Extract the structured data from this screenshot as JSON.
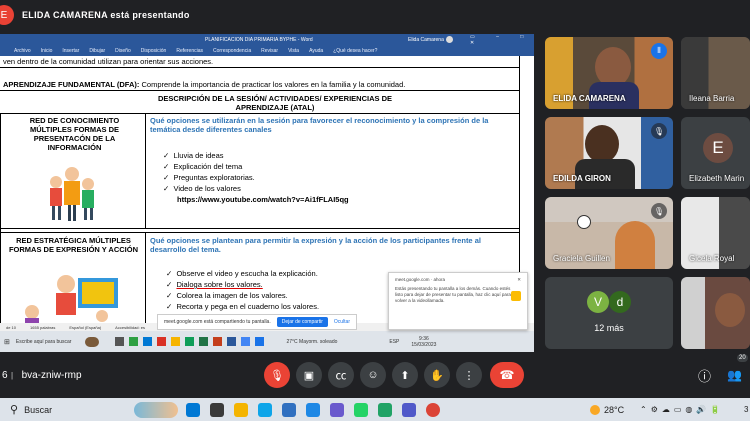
{
  "presenter": {
    "text": "ELIDA CAMARENA está presentando"
  },
  "word": {
    "title": "PLANIFICACION DIA   PRIMARIA BYPHE  -  Word",
    "user": "Elida Camarena",
    "menu": [
      "Archivo",
      "Inicio",
      "Insertar",
      "Dibujar",
      "Diseño",
      "Disposición",
      "Referencias",
      "Correspondencia",
      "Revisar",
      "Vista",
      "Ayuda",
      "¿Qué desea hacer?"
    ],
    "top_fragment": "ven dentro de la comunidad utilizan para orientar sus acciones.",
    "dfa_label": "APRENDIZAJE FUNDAMENTAL (DFA):",
    "dfa_text": "Comprende la importancia de practicar los valores en la familia y la comunidad.",
    "header_line1": "DESCRIPCIÓN DE LA SESIÓN/ ACTIVIDADES/ EXPERIENCIAS DE",
    "header_line2": "APRENDIZAJE (ATAL)",
    "red1_title": "RED DE CONOCIMIENTO MÚLTIPLES FORMAS DE PRESENTACÓN DE LA INFORMACIÓN",
    "red1_question": "Qué opciones se utilizarán en la sesión para favorecer el reconocimiento y la compresión de la temática desde diferentes canales",
    "red1_items": [
      "Lluvia de ideas",
      "Explicación del tema",
      "Preguntas exploratorias.",
      "Video de los valores"
    ],
    "red1_link": "https://www.youtube.com/watch?v=Ai1fFLAI5qg",
    "red2_title": "RED ESTRATÉGICA MÚLTIPLES FORMAS DE EXPRESIÓN Y ACCIÓN",
    "red2_question": "Qué opciones se plantean para permitir la expresión y la acción de los participantes frente al desarrollo del tema.",
    "red2_items": [
      "Observe el video y escucha la explicación.",
      "Dialoga sobre los valores.",
      "Colorea la imagen de los valores.",
      "Recorta y pega en el cuaderno los valores."
    ],
    "status": [
      "de 10",
      "1655 palabras",
      "Español (España)",
      "Accesibilidad: es"
    ],
    "share_notice": "meet.google.com está compartiendo tu pantalla.",
    "share_btn": "Dejar de compartir",
    "hide_btn": "Ocultar",
    "popup_source": "meet.google.com · ahora",
    "popup_text": "Estás presentando tu pantalla a los demás. Cuando estés listo para dejar de presentar tu pantalla, haz clic aquí para volver a la videollamada.",
    "inner_search": "Escribe aquí para buscar",
    "inner_weather": "27°C  Mayorm. soleado",
    "inner_lang": "ESP",
    "inner_time": "9:36",
    "inner_date": "15/03/2023"
  },
  "participants": [
    {
      "name": "ELIDA CAMARENA",
      "color": "#6a5a4a"
    },
    {
      "name": "Ileana Barria",
      "color": "#4a4440"
    },
    {
      "name": "EDILDA GIRON",
      "color": "#5a4a3a"
    },
    {
      "name": "Elizabeth Marin",
      "color": "#3c4043"
    },
    {
      "name": "Graciela Guillen",
      "color": "#7a6a5a"
    },
    {
      "name": "Gicela Royal",
      "color": "#5a5a5a"
    },
    {
      "name": "12 más",
      "color": "#3c4043"
    },
    {
      "name": "",
      "color": "#5a4a4a"
    }
  ],
  "more_avatars": [
    "V",
    "d"
  ],
  "elizabeth_initial": "E",
  "meeting_code": "bva-zniw-rmp",
  "time_prefix": "6",
  "self_count": "20",
  "taskbar": {
    "search": "Buscar",
    "temp": "28°C",
    "tray_fragment": "3"
  }
}
